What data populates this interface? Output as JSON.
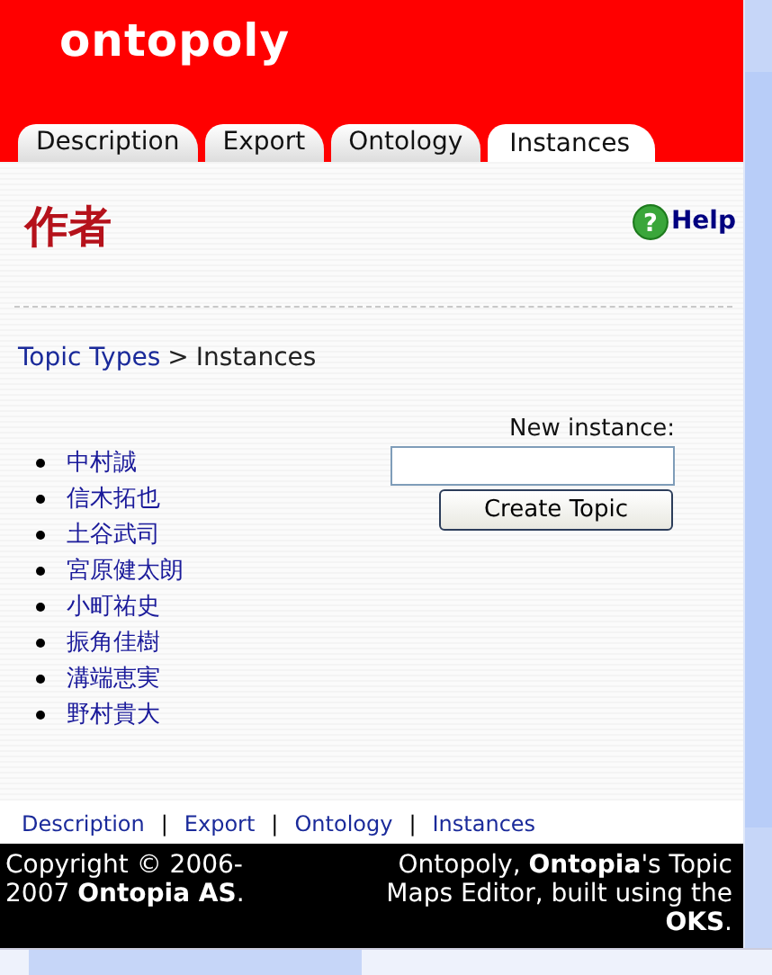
{
  "logo": "ontopoly",
  "tabs": [
    {
      "label": "Description",
      "selected": false
    },
    {
      "label": "Export",
      "selected": false
    },
    {
      "label": "Ontology",
      "selected": false
    },
    {
      "label": "Instances",
      "selected": true
    }
  ],
  "page_title": "作者",
  "help_icon": "?",
  "help": "Help",
  "breadcrumb": {
    "link": "Topic Types",
    "separator": ">",
    "current": "Instances"
  },
  "instances": [
    "中村誠",
    "信木拓也",
    "土谷武司",
    "宮原健太朗",
    "小町祐史",
    "振角佳樹",
    "溝端恵実",
    "野村貴大"
  ],
  "new_instance": {
    "label": "New instance:",
    "button": "Create Topic"
  },
  "footer_links": [
    "Description",
    "Export",
    "Ontology",
    "Instances"
  ],
  "footer_separator": "|",
  "copyright": "Copyright © 2006-2007 **Ontopia AS**.",
  "credits": "Ontopoly, **Ontopia**'s Topic Maps Editor, built using the **OKS**."
}
